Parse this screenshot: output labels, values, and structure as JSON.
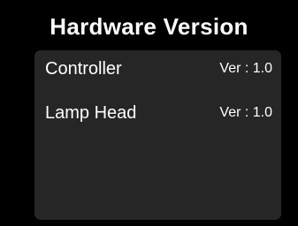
{
  "page": {
    "title": "Hardware Version"
  },
  "items": [
    {
      "name": "Controller",
      "version": "Ver : 1.0"
    },
    {
      "name": "Lamp Head",
      "version": "Ver : 1.0"
    }
  ],
  "colors": {
    "background": "#000000",
    "panel": "#262626",
    "text": "#ffffff"
  }
}
